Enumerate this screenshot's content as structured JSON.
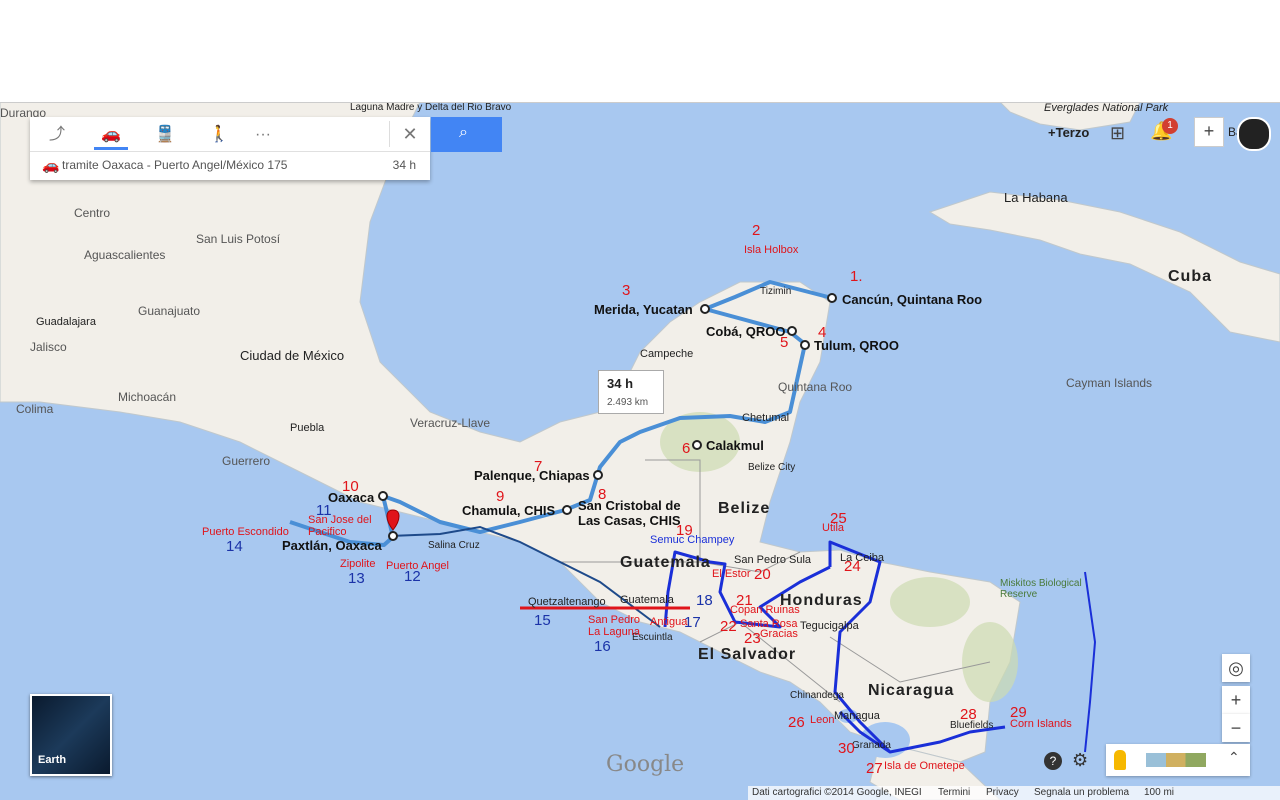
{
  "directions": {
    "modes": [
      {
        "name": "directions",
        "icon": "directions-icon"
      },
      {
        "name": "drive",
        "icon": "car-icon",
        "active": true
      },
      {
        "name": "transit",
        "icon": "train-icon"
      },
      {
        "name": "walk",
        "icon": "walk-icon"
      },
      {
        "name": "more",
        "icon": "more-icon",
        "label": "···"
      }
    ],
    "close_label": "✕",
    "route_via": "tramite Oaxaca - Puerto Angel/México 175",
    "route_duration": "34 h"
  },
  "search_icon": "⌕",
  "account": {
    "plus_label": "+Terzo",
    "notifications": "1",
    "add_label": "+",
    "user_short": "Ba"
  },
  "route_bubble": {
    "duration": "34 h",
    "distance": "2.493 km"
  },
  "earth_label": "Earth",
  "google_logo": "Google",
  "controls": {
    "zoom_in": "+",
    "zoom_out": "−"
  },
  "footer": {
    "copyright": "Dati cartografici ©2014 Google, INEGI",
    "terms": "Termini",
    "privacy": "Privacy",
    "report": "Segnala un problema",
    "scale": "100 mi"
  },
  "map_labels": {
    "countries": [
      "Cuba",
      "Belize",
      "Guatemala",
      "Honduras",
      "El Salvador",
      "Nicaragua"
    ],
    "regions": [
      "Quintana Roo",
      "Cayman Islands",
      "Veracruz-Llave",
      "Michoacán",
      "Guerrero",
      "Colima",
      "Jalisco",
      "Guanajuato",
      "San Luis Potosí",
      "Durango",
      "Centro",
      "Aguascalientes"
    ],
    "cities": [
      "La Habana",
      "Campeche",
      "Chetumal",
      "Belize City",
      "San Pedro Sula",
      "La Ceiba",
      "Tegucigalpa",
      "Managua",
      "Granada",
      "Bluefields",
      "Guadalajara",
      "Ciudad de México",
      "Puebla",
      "Salina Cruz",
      "Escuintla",
      "Chinandega",
      "Quetzaltenango",
      "Guatemala",
      "Tizimin",
      "Everglades National Park",
      "Laguna Madre y Delta del Rio Bravo"
    ],
    "waypoints": [
      "Cancún, Quintana Roo",
      "Merida, Yucatan",
      "Cobá, QROO",
      "Tulum, QROO",
      "Calakmul",
      "Palenque, Chiapas",
      "San Cristobal de Las Casas, CHIS",
      "Chamula, CHIS",
      "Oaxaca",
      "Paxtlán, Oaxaca"
    ],
    "annotations": [
      "Isla Holbox",
      "Puerto Escondido",
      "San Jose del Pacifico",
      "Zipolite",
      "Puerto Angel",
      "Semuc Champey",
      "El Estor",
      "Copan Ruinas",
      "Santa Rosa",
      "Gracias",
      "Utila",
      "Leon",
      "Isla de Ometepe",
      "Corn Islands",
      "San Pedro La Laguna",
      "Antigua",
      "Miskitos Biological Reserve"
    ],
    "numbers": [
      "1.",
      "2",
      "3",
      "4",
      "5",
      "6",
      "7",
      "8",
      "9",
      "10",
      "11",
      "12",
      "13",
      "14",
      "15",
      "16",
      "17",
      "18",
      "19",
      "20",
      "21",
      "22",
      "23",
      "24",
      "25",
      "26",
      "27",
      "28",
      "29",
      "30"
    ]
  },
  "colors": {
    "land": "#f2efe9",
    "water": "#a8c8f0",
    "route": "#4a8fd6",
    "hand_route": "#1a2fd8",
    "annotation_red": "#e0141a",
    "accent": "#4285f4"
  }
}
